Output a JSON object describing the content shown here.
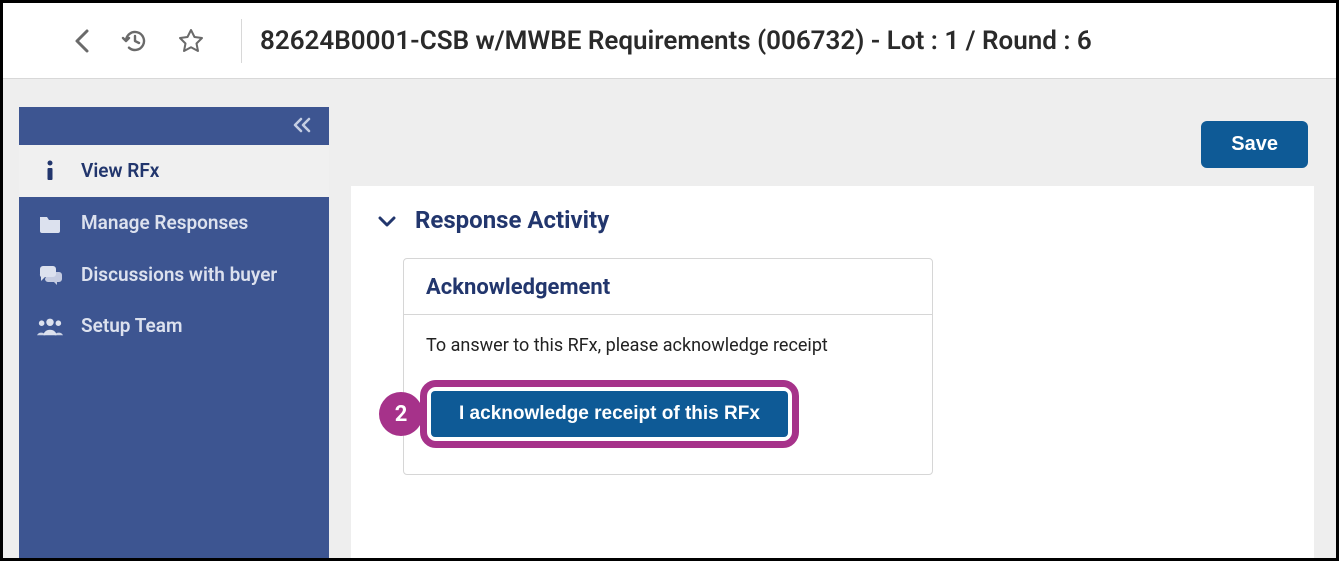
{
  "header": {
    "title": "82624B0001-CSB w/MWBE Requirements (006732) - Lot : 1 / Round : 6"
  },
  "sidebar": {
    "items": [
      {
        "label": "View RFx"
      },
      {
        "label": "Manage Responses"
      },
      {
        "label": "Discussions with buyer"
      },
      {
        "label": "Setup Team"
      }
    ]
  },
  "actions": {
    "save": "Save"
  },
  "panel": {
    "title": "Response Activity",
    "ack": {
      "title": "Acknowledgement",
      "message": "To answer to this RFx, please acknowledge receipt",
      "button": "I acknowledge receipt of this RFx"
    }
  },
  "annotation": {
    "step": "2"
  }
}
